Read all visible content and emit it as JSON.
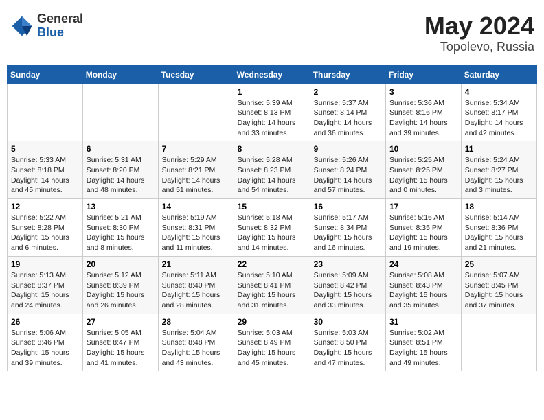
{
  "header": {
    "logo_general": "General",
    "logo_blue": "Blue",
    "title_month": "May 2024",
    "title_location": "Topolevo, Russia"
  },
  "days_of_week": [
    "Sunday",
    "Monday",
    "Tuesday",
    "Wednesday",
    "Thursday",
    "Friday",
    "Saturday"
  ],
  "weeks": [
    [
      {
        "day": "",
        "info": ""
      },
      {
        "day": "",
        "info": ""
      },
      {
        "day": "",
        "info": ""
      },
      {
        "day": "1",
        "info": "Sunrise: 5:39 AM\nSunset: 8:13 PM\nDaylight: 14 hours\nand 33 minutes."
      },
      {
        "day": "2",
        "info": "Sunrise: 5:37 AM\nSunset: 8:14 PM\nDaylight: 14 hours\nand 36 minutes."
      },
      {
        "day": "3",
        "info": "Sunrise: 5:36 AM\nSunset: 8:16 PM\nDaylight: 14 hours\nand 39 minutes."
      },
      {
        "day": "4",
        "info": "Sunrise: 5:34 AM\nSunset: 8:17 PM\nDaylight: 14 hours\nand 42 minutes."
      }
    ],
    [
      {
        "day": "5",
        "info": "Sunrise: 5:33 AM\nSunset: 8:18 PM\nDaylight: 14 hours\nand 45 minutes."
      },
      {
        "day": "6",
        "info": "Sunrise: 5:31 AM\nSunset: 8:20 PM\nDaylight: 14 hours\nand 48 minutes."
      },
      {
        "day": "7",
        "info": "Sunrise: 5:29 AM\nSunset: 8:21 PM\nDaylight: 14 hours\nand 51 minutes."
      },
      {
        "day": "8",
        "info": "Sunrise: 5:28 AM\nSunset: 8:23 PM\nDaylight: 14 hours\nand 54 minutes."
      },
      {
        "day": "9",
        "info": "Sunrise: 5:26 AM\nSunset: 8:24 PM\nDaylight: 14 hours\nand 57 minutes."
      },
      {
        "day": "10",
        "info": "Sunrise: 5:25 AM\nSunset: 8:25 PM\nDaylight: 15 hours\nand 0 minutes."
      },
      {
        "day": "11",
        "info": "Sunrise: 5:24 AM\nSunset: 8:27 PM\nDaylight: 15 hours\nand 3 minutes."
      }
    ],
    [
      {
        "day": "12",
        "info": "Sunrise: 5:22 AM\nSunset: 8:28 PM\nDaylight: 15 hours\nand 6 minutes."
      },
      {
        "day": "13",
        "info": "Sunrise: 5:21 AM\nSunset: 8:30 PM\nDaylight: 15 hours\nand 8 minutes."
      },
      {
        "day": "14",
        "info": "Sunrise: 5:19 AM\nSunset: 8:31 PM\nDaylight: 15 hours\nand 11 minutes."
      },
      {
        "day": "15",
        "info": "Sunrise: 5:18 AM\nSunset: 8:32 PM\nDaylight: 15 hours\nand 14 minutes."
      },
      {
        "day": "16",
        "info": "Sunrise: 5:17 AM\nSunset: 8:34 PM\nDaylight: 15 hours\nand 16 minutes."
      },
      {
        "day": "17",
        "info": "Sunrise: 5:16 AM\nSunset: 8:35 PM\nDaylight: 15 hours\nand 19 minutes."
      },
      {
        "day": "18",
        "info": "Sunrise: 5:14 AM\nSunset: 8:36 PM\nDaylight: 15 hours\nand 21 minutes."
      }
    ],
    [
      {
        "day": "19",
        "info": "Sunrise: 5:13 AM\nSunset: 8:37 PM\nDaylight: 15 hours\nand 24 minutes."
      },
      {
        "day": "20",
        "info": "Sunrise: 5:12 AM\nSunset: 8:39 PM\nDaylight: 15 hours\nand 26 minutes."
      },
      {
        "day": "21",
        "info": "Sunrise: 5:11 AM\nSunset: 8:40 PM\nDaylight: 15 hours\nand 28 minutes."
      },
      {
        "day": "22",
        "info": "Sunrise: 5:10 AM\nSunset: 8:41 PM\nDaylight: 15 hours\nand 31 minutes."
      },
      {
        "day": "23",
        "info": "Sunrise: 5:09 AM\nSunset: 8:42 PM\nDaylight: 15 hours\nand 33 minutes."
      },
      {
        "day": "24",
        "info": "Sunrise: 5:08 AM\nSunset: 8:43 PM\nDaylight: 15 hours\nand 35 minutes."
      },
      {
        "day": "25",
        "info": "Sunrise: 5:07 AM\nSunset: 8:45 PM\nDaylight: 15 hours\nand 37 minutes."
      }
    ],
    [
      {
        "day": "26",
        "info": "Sunrise: 5:06 AM\nSunset: 8:46 PM\nDaylight: 15 hours\nand 39 minutes."
      },
      {
        "day": "27",
        "info": "Sunrise: 5:05 AM\nSunset: 8:47 PM\nDaylight: 15 hours\nand 41 minutes."
      },
      {
        "day": "28",
        "info": "Sunrise: 5:04 AM\nSunset: 8:48 PM\nDaylight: 15 hours\nand 43 minutes."
      },
      {
        "day": "29",
        "info": "Sunrise: 5:03 AM\nSunset: 8:49 PM\nDaylight: 15 hours\nand 45 minutes."
      },
      {
        "day": "30",
        "info": "Sunrise: 5:03 AM\nSunset: 8:50 PM\nDaylight: 15 hours\nand 47 minutes."
      },
      {
        "day": "31",
        "info": "Sunrise: 5:02 AM\nSunset: 8:51 PM\nDaylight: 15 hours\nand 49 minutes."
      },
      {
        "day": "",
        "info": ""
      }
    ]
  ]
}
